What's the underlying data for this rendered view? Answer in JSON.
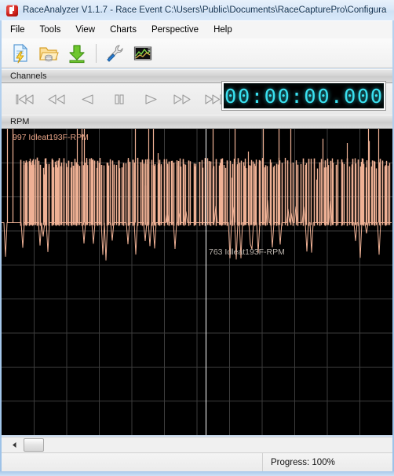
{
  "window": {
    "title": "RaceAnalyzer V1.1.7 - Race Event C:\\Users\\Public\\Documents\\RaceCapturePro\\Configura",
    "app_icon": "race-analyzer-icon"
  },
  "menu": {
    "items": [
      {
        "label": "File"
      },
      {
        "label": "Tools"
      },
      {
        "label": "View"
      },
      {
        "label": "Charts"
      },
      {
        "label": "Perspective"
      },
      {
        "label": "Help"
      }
    ]
  },
  "toolbar": {
    "buttons": [
      {
        "name": "new-document-icon",
        "tooltip": "New"
      },
      {
        "name": "open-database-folder-icon",
        "tooltip": "Open"
      },
      {
        "name": "download-arrow-icon",
        "tooltip": "Import"
      },
      {
        "name": "wrench-tool-icon",
        "tooltip": "Configure"
      },
      {
        "name": "chart-window-icon",
        "tooltip": "Add Chart"
      }
    ]
  },
  "channels_panel": {
    "title": "Channels",
    "transport": [
      {
        "name": "skip-to-start-icon"
      },
      {
        "name": "rewind-icon"
      },
      {
        "name": "step-back-icon"
      },
      {
        "name": "pause-icon"
      },
      {
        "name": "play-icon"
      },
      {
        "name": "fast-forward-icon"
      },
      {
        "name": "skip-to-end-icon"
      }
    ],
    "timer": "00:00:00.000",
    "timer_color": "#39e0ef"
  },
  "chart_panel": {
    "title": "RPM",
    "series_labels": [
      {
        "text": "997 Idleat193F-RPM",
        "color": "#e8a487"
      },
      {
        "text": "763 Idleat193F-RPM",
        "color": "#b9b2ab"
      }
    ]
  },
  "chart_data": {
    "type": "line",
    "title": "RPM",
    "xlabel": "",
    "ylabel": "RPM",
    "background": "#000000",
    "grid": true,
    "grid_color": "#3c3c3c",
    "grid_cols": 12,
    "grid_rows": 9,
    "legend": "inline-labels",
    "cursor_x_fraction": 0.522,
    "cursor_color": "#ffffff",
    "ylim": [
      0,
      1100
    ],
    "series": [
      {
        "name": "997 Idleat193F-RPM",
        "color": "#efb195",
        "baseline": 763,
        "peak": 997,
        "description": "Dense vertical RPM spikes from idle baseline to rev-limit across full log"
      },
      {
        "name": "763 Idleat193F-RPM",
        "color": "#b9b2ab",
        "baseline": 763,
        "description": "Idle reference at 193F"
      }
    ],
    "spikes_fractions": [
      0.048,
      0.056,
      0.062,
      0.07,
      0.078,
      0.09,
      0.098,
      0.112,
      0.12,
      0.128,
      0.138,
      0.146,
      0.158,
      0.17,
      0.178,
      0.19,
      0.204,
      0.212,
      0.224,
      0.236,
      0.244,
      0.256,
      0.27,
      0.284,
      0.3,
      0.312,
      0.324,
      0.336,
      0.348,
      0.36,
      0.372,
      0.384,
      0.392,
      0.404,
      0.416,
      0.428,
      0.44,
      0.452,
      0.466,
      0.478,
      0.492,
      0.506,
      0.52,
      0.534,
      0.548,
      0.562,
      0.576,
      0.59,
      0.604,
      0.618,
      0.632,
      0.646,
      0.66,
      0.674,
      0.688,
      0.702,
      0.716,
      0.73,
      0.744,
      0.758,
      0.772,
      0.786,
      0.8,
      0.814,
      0.828,
      0.842,
      0.856,
      0.87,
      0.884,
      0.898,
      0.912,
      0.926,
      0.94,
      0.954,
      0.968,
      0.982
    ]
  },
  "scrollbar": {
    "left_arrow": "scroll-left-arrow-icon",
    "thumb_position": 0.02
  },
  "statusbar": {
    "progress_text": "Progress: 100%"
  }
}
